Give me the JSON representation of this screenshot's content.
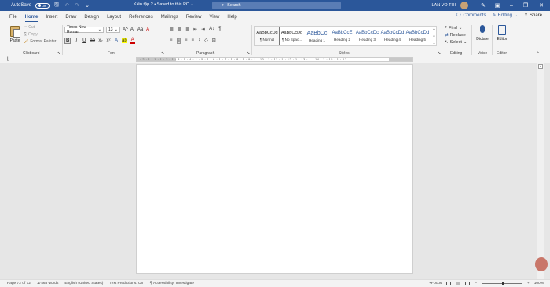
{
  "titlebar": {
    "autosave_label": "AutoSave",
    "autosave_state": "Off",
    "doc_title": "Kiến tập 2 • Saved to this PC ⌄",
    "search_placeholder": "Search",
    "user_name": "LAN VO THI"
  },
  "tabs": [
    {
      "label": "File"
    },
    {
      "label": "Home",
      "active": true
    },
    {
      "label": "Insert"
    },
    {
      "label": "Draw"
    },
    {
      "label": "Design"
    },
    {
      "label": "Layout"
    },
    {
      "label": "References"
    },
    {
      "label": "Mailings"
    },
    {
      "label": "Review"
    },
    {
      "label": "View"
    },
    {
      "label": "Help"
    }
  ],
  "tab_actions": {
    "comments": "Comments",
    "editing": "Editing",
    "share": "Share"
  },
  "clipboard": {
    "paste": "Paste",
    "cut": "Cut",
    "copy": "Copy",
    "format_painter": "Format Painter",
    "group_label": "Clipboard"
  },
  "font": {
    "name": "Times New Roman",
    "size": "13",
    "grow": "A^",
    "shrink": "Aˇ",
    "case": "Aa",
    "clear": "A",
    "bold": "B",
    "italic": "I",
    "underline": "U",
    "strike": "ab",
    "subscript": "x₂",
    "superscript": "x²",
    "effects": "A",
    "highlight": "ab",
    "color": "A",
    "group_label": "Font"
  },
  "paragraph": {
    "bullets": "≣",
    "numbering": "≣",
    "multilevel": "≣",
    "decrease_indent": "⇤",
    "increase_indent": "⇥",
    "sort": "A↓",
    "show_marks": "¶",
    "align_left": "≡",
    "align_center": "≡",
    "align_right": "≡",
    "justify": "≡",
    "line_spacing": "↕",
    "shading": "◇",
    "borders": "⊞",
    "group_label": "Paragraph"
  },
  "styles": {
    "items": [
      {
        "preview": "AaBbCcDd",
        "name": "¶ Normal"
      },
      {
        "preview": "AaBbCcDd",
        "name": "¶ No Spac..."
      },
      {
        "preview": "AaBbCc",
        "name": "Heading 1"
      },
      {
        "preview": "AaBbCcE",
        "name": "Heading 2"
      },
      {
        "preview": "AaBbCcDc",
        "name": "Heading 3"
      },
      {
        "preview": "AaBbCcDd",
        "name": "Heading 4"
      },
      {
        "preview": "AaBbCcDd",
        "name": "Heading 5"
      }
    ],
    "group_label": "Styles"
  },
  "editing": {
    "find": "Find",
    "replace": "Replace",
    "select": "Select",
    "group_label": "Editing"
  },
  "voice": {
    "dictate": "Dictate",
    "group_label": "Voice"
  },
  "editor_group": {
    "editor": "Editor",
    "group_label": "Editor"
  },
  "ruler": {
    "text": "· 2 · 1 · 1 · 1 · 2 · 1 · 3 · 1 · 4 · 1 · 5 · 1 · 6 · 1 · 7 · 1 · 8 · 1 · 9 · 1 · 10 · 1 · 11 · 1 · 12 · 1 · 13 · 1 · 14 · 1 · 15 · 1 · 17"
  },
  "status": {
    "page": "Page 72 of 72",
    "words": "17468 words",
    "language": "English (United States)",
    "predictions": "Text Predictions: On",
    "accessibility": "Accessibility: Investigate",
    "focus": "Focus",
    "zoom": "100%"
  },
  "colors": {
    "brand": "#2b579a"
  }
}
